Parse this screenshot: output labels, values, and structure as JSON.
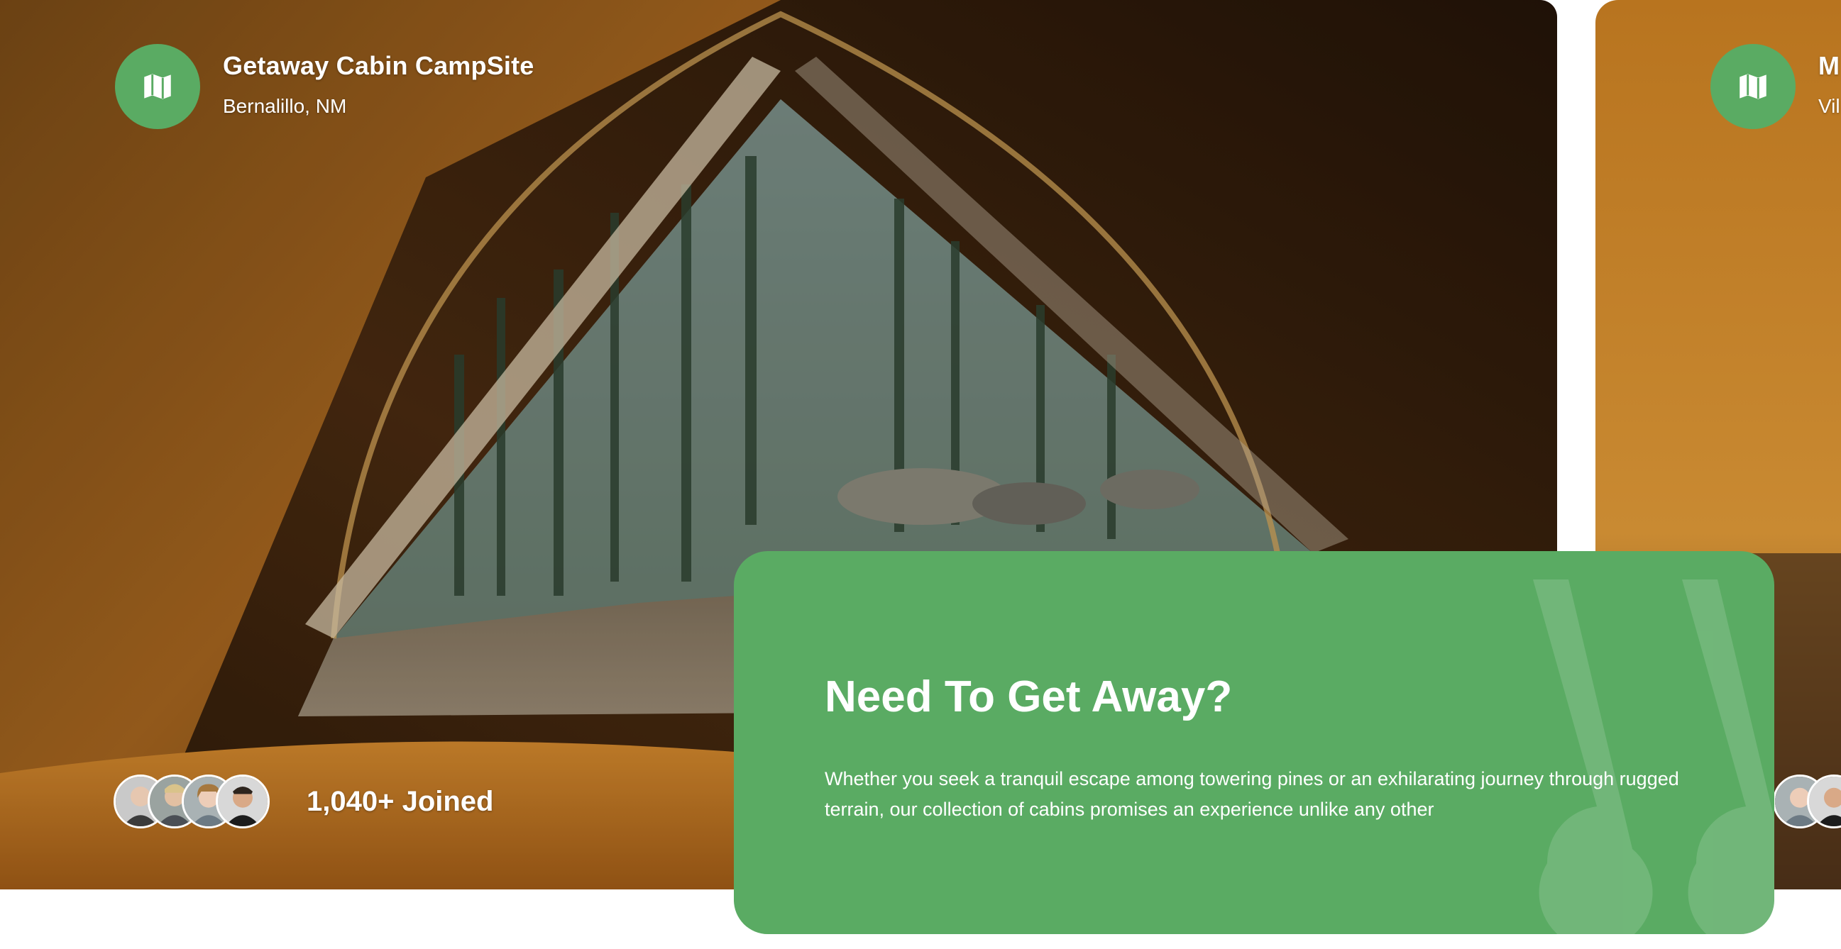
{
  "cards": [
    {
      "title": "Getaway Cabin CampSite",
      "location": "Bernalillo, NM",
      "joined": "1,040+ Joined",
      "icon": "map-icon"
    },
    {
      "title": "M",
      "location": "Vil",
      "icon": "map-icon"
    }
  ],
  "cta": {
    "title": "Need To Get Away?",
    "body": "Whether you seek a tranquil escape among towering pines or an exhilarating journey through rugged terrain, our collection of cabins promises an experience unlike any other"
  },
  "colors": {
    "brand_green": "#5aab63",
    "text": "#ffffff"
  }
}
